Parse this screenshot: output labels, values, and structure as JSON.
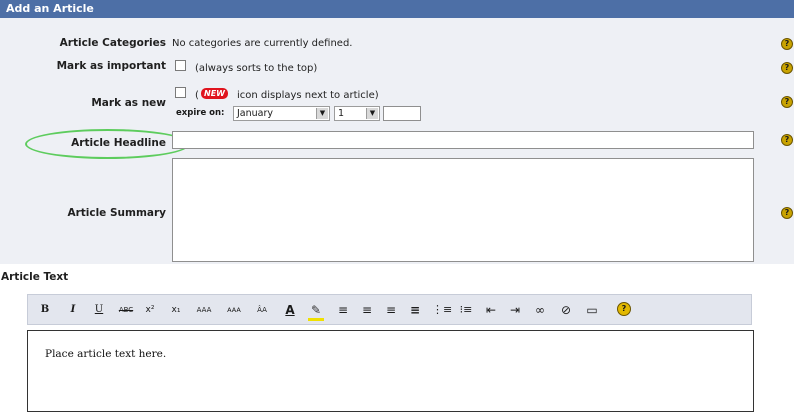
{
  "panel": {
    "title": "Add an Article"
  },
  "categories": {
    "label": "Article Categories",
    "value": "No categories are currently defined."
  },
  "important": {
    "label": "Mark as important",
    "hint": "(always sorts to the top)"
  },
  "new_mark": {
    "label": "Mark as new",
    "open_paren": "(",
    "badge": "NEW",
    "hint": "icon displays next to article)",
    "expire_label": "expire on:",
    "month": "January",
    "day": "1",
    "year": ""
  },
  "headline": {
    "label": "Article Headline",
    "value": ""
  },
  "summary": {
    "label": "Article Summary",
    "value": ""
  },
  "article_text": {
    "label": "Article Text",
    "content": "Place article text here."
  },
  "toolbar": {
    "buttons": [
      {
        "name": "bold-icon",
        "glyph": "B"
      },
      {
        "name": "italic-icon",
        "glyph": "I"
      },
      {
        "name": "underline-icon",
        "glyph": "U"
      },
      {
        "name": "strikethrough-icon",
        "glyph": "ABC"
      },
      {
        "name": "superscript-icon",
        "glyph": "x²"
      },
      {
        "name": "subscript-icon",
        "glyph": "x₁"
      },
      {
        "name": "font-size-increase-icon",
        "glyph": "AAA"
      },
      {
        "name": "font-size-decrease-icon",
        "glyph": "AAA"
      },
      {
        "name": "font-icon",
        "glyph": "ÂA"
      },
      {
        "name": "text-color-icon",
        "glyph": "A"
      },
      {
        "name": "highlight-color-icon",
        "glyph": "✎"
      },
      {
        "name": "align-left-icon",
        "glyph": "≡"
      },
      {
        "name": "align-center-icon",
        "glyph": "≡"
      },
      {
        "name": "align-right-icon",
        "glyph": "≡"
      },
      {
        "name": "align-justify-icon",
        "glyph": "≡"
      },
      {
        "name": "ordered-list-icon",
        "glyph": "⋮≡"
      },
      {
        "name": "unordered-list-icon",
        "glyph": "⁝≡"
      },
      {
        "name": "outdent-icon",
        "glyph": "⇤"
      },
      {
        "name": "indent-icon",
        "glyph": "⇥"
      },
      {
        "name": "link-icon",
        "glyph": "∞"
      },
      {
        "name": "unlink-icon",
        "glyph": "⊘"
      },
      {
        "name": "table-icon",
        "glyph": "▭"
      },
      {
        "name": "help-icon",
        "glyph": "?"
      }
    ]
  },
  "colors": {
    "title_bar": "#4d6fa6",
    "form_bg": "#eef0f5",
    "highlight_oval": "#5dcc5d",
    "help_icon": "#c9a300",
    "new_badge": "#e0141e"
  }
}
